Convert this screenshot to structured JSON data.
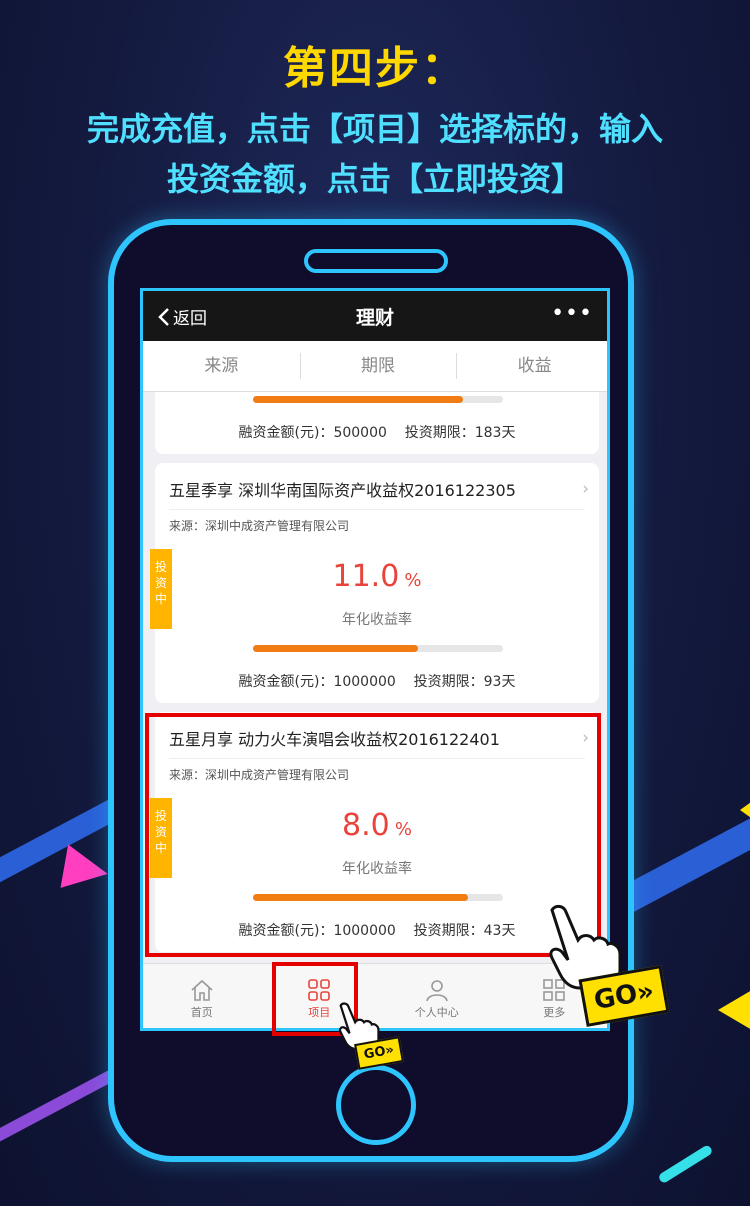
{
  "banner": {
    "title": "第四步：",
    "desc_line1": "完成充值，点击【项目】选择标的，输入",
    "desc_line2": "投资金额，点击【立即投资】"
  },
  "navbar": {
    "back_label": "返回",
    "title": "理财",
    "more_label": "•••"
  },
  "filters": [
    "来源",
    "期限",
    "收益"
  ],
  "partial_card": {
    "progress": 0.84,
    "amount": "融资金额(元)：500000",
    "term": "投资期限：183天"
  },
  "cards": [
    {
      "title": "五星季享 深圳华南国际资产收益权2016122305",
      "source": "来源：深圳中成资产管理有限公司",
      "tag": "投资中",
      "rate": "11.0",
      "rate_unit": "%",
      "rate_label": "年化收益率",
      "progress": 0.66,
      "amount": "融资金额(元)：1000000",
      "term": "投资期限：93天"
    },
    {
      "title": "五星月享 动力火车演唱会收益权2016122401",
      "source": "来源：深圳中成资产管理有限公司",
      "tag": "投资中",
      "rate": "8.0",
      "rate_unit": "%",
      "rate_label": "年化收益率",
      "progress": 0.86,
      "amount": "融资金额(元)：1000000",
      "term": "投资期限：43天"
    }
  ],
  "tabbar": [
    {
      "label": "首页",
      "icon": "home-icon"
    },
    {
      "label": "项目",
      "icon": "grid-icon",
      "active": true
    },
    {
      "label": "个人中心",
      "icon": "user-icon"
    },
    {
      "label": "更多",
      "icon": "more-grid-icon"
    }
  ],
  "go_badge": "GO»",
  "colors": {
    "accent": "#e8443b",
    "progress": "#f07c12",
    "tag": "#ffb400",
    "frame": "#2ec5ff",
    "title": "#ffd800",
    "subtitle": "#4fe0ff",
    "highlight": "#e50000"
  }
}
